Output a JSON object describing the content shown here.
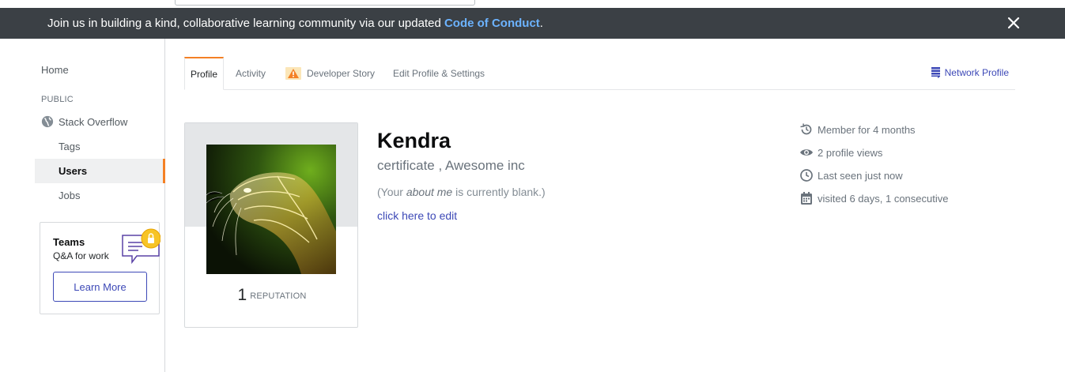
{
  "banner": {
    "message": "Join us in building a kind, collaborative learning community via our updated ",
    "link": "Code of Conduct",
    "suffix": "."
  },
  "sidebar": {
    "home": "Home",
    "public_heading": "PUBLIC",
    "site": "Stack Overflow",
    "items": [
      "Tags",
      "Users",
      "Jobs"
    ],
    "active_item": "Users"
  },
  "teams": {
    "title": "Teams",
    "subtitle": "Q&A for work",
    "button": "Learn More"
  },
  "tabs": {
    "items": [
      "Profile",
      "Activity",
      "Developer Story",
      "Edit Profile & Settings"
    ],
    "active": "Profile",
    "network_profile": "Network Profile"
  },
  "profile": {
    "name": "Kendra",
    "title": "certificate , Awesome inc",
    "about_prefix": "(Your ",
    "about_em": "about me",
    "about_suffix": " is currently blank.)",
    "edit_link": "click here to edit",
    "reputation": "1",
    "reputation_label": "REPUTATION"
  },
  "stats": {
    "member": "Member for 4 months",
    "views": "2 profile views",
    "last_seen": "Last seen just now",
    "visited": "visited 6 days, 1 consecutive"
  },
  "colors": {
    "accent": "#f48024",
    "link": "#3d49b7",
    "banner_bg": "#3b4045",
    "banner_link": "#6cb3ff"
  }
}
